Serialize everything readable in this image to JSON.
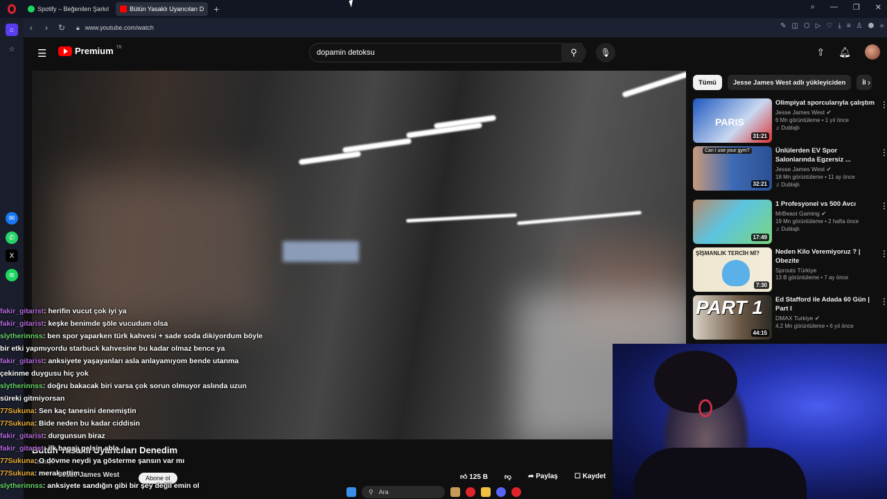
{
  "browser": {
    "tabs": [
      {
        "label": "Spotify – Beğenilen Şarkıl"
      },
      {
        "label": "Bütün Yasaklı Uyarıcıları D"
      }
    ],
    "url": "www.youtube.com/watch"
  },
  "youtube": {
    "logo_text": "Premium",
    "logo_sup": "TR",
    "search_value": "dopamin detoksu"
  },
  "video": {
    "title": "Bütün Yasaklı Uyarıcıları Denedim",
    "channel": "Jesse James West",
    "subscribe_label": "Abone ol",
    "likes": "125 B",
    "share_label": "Paylaş",
    "save_label": "Kaydet",
    "badge_top": "Dublajlı"
  },
  "chat": [
    {
      "user": "fakir_gitarist",
      "text": ": herifin vucut çok iyi ya",
      "cls": "u"
    },
    {
      "user": "fakir_gitarist",
      "text": ": keşke benimde şöle vucudum olsa",
      "cls": "u"
    },
    {
      "user": "slytherinnss",
      "text": ": ben spor yaparken türk kahvesi + sade soda dikiyordum böyle bir etki yapmıyordu starbuck kahvesine bu kadar olmaz bence ya",
      "cls": "u2"
    },
    {
      "user": "fakir_gitarist",
      "text": ": anksiyete yaşayanları asla anlayamıyom bende utanma çekinme duygusu hiç yok",
      "cls": "u"
    },
    {
      "user": "slytherinnss",
      "text": ": doğru bakacak biri varsa çok sorun olmuyor aslında uzun süreki gitmiyorsan",
      "cls": "u2"
    },
    {
      "user": "77Sukuna",
      "text": ": Sen kaç tanesini denemiştin",
      "cls": "u3"
    },
    {
      "user": "77Sukuna",
      "text": ": Bide neden bu kadar ciddisin",
      "cls": "u3"
    },
    {
      "user": "fakir_gitarist",
      "text": ": durgunsun biraz",
      "cls": "u"
    },
    {
      "user": "fakir_gitarist",
      "text": ": ilk bagajı gelsin abla",
      "cls": "u"
    },
    {
      "user": "77Sukuna",
      "text": ": O dövme neydi ya gösterme şansın var mı",
      "cls": "u3"
    },
    {
      "user": "77Sukuna",
      "text": ": merak ettim",
      "cls": "u3"
    },
    {
      "user": "slytherinnss",
      "text": ": anksiyete sandığın gibi bir şey değil emin ol",
      "cls": "u2"
    }
  ],
  "chips": [
    "Tümü",
    "Jesse James West adlı yükleyiciden",
    "İl"
  ],
  "recommendations": [
    {
      "title": "Olimpiyat sporcularıyla çalıştım",
      "channel": "Jesse James West",
      "meta": "6 Mn görüntüleme • 1 yıl önce",
      "badge": "Dublajlı",
      "duration": "31:21",
      "thumb": "#2f6fd0"
    },
    {
      "title": "Ünlülerden EV Spor Salonlarında Egzersiz ...",
      "channel": "Jesse James West",
      "meta": "18 Mn görüntüleme • 11 ay önce",
      "badge": "Dublajlı",
      "duration": "32:21",
      "thumb": "#4b7cc9"
    },
    {
      "title": "1 Profesyonel vs 500 Avcı",
      "channel": "MrBeast Gaming",
      "meta": "19 Mn görüntüleme • 2 hafta önce",
      "badge": "Dublajlı",
      "duration": "17:49",
      "thumb": "#4fb8d8"
    },
    {
      "title": "Neden Kilo Veremiyoruz ? | Obezite",
      "channel": "Sprouts Türkiye",
      "meta": "13 B görüntüleme • 7 ay önce",
      "badge": "",
      "duration": "7:30",
      "thumb": "#e8e0c8"
    },
    {
      "title": "Ed Stafford ile Adada 60 Gün | Part I",
      "channel": "DMAX Turkiye",
      "meta": "4,2 Mn görüntüleme • 6 yıl önce",
      "badge": "",
      "duration": "44:15",
      "thumb": "#5a4a3a"
    }
  ],
  "thumb_text": {
    "r0": "PARIS",
    "r1": "Can I use your gym?",
    "r3": "ŞİŞMANLIK TERCİH Mİ?",
    "r4": "PART 1"
  },
  "taskbar": {
    "search_placeholder": "Ara"
  },
  "colors": {
    "yt_red": "#ff0000",
    "chat_purple": "#b46bdc",
    "chat_green": "#6ad66a",
    "chat_orange": "#f0b23a"
  }
}
